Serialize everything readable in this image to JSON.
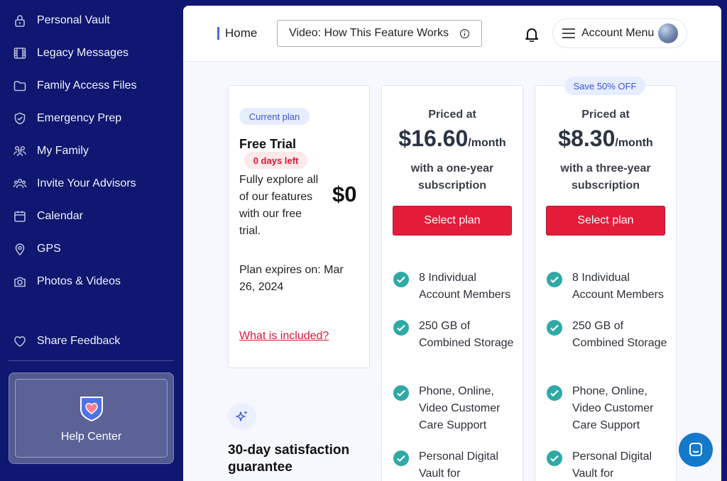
{
  "sidebar": {
    "items": [
      {
        "label": "Personal Vault",
        "icon": "lock-icon"
      },
      {
        "label": "Legacy Messages",
        "icon": "film-icon"
      },
      {
        "label": "Family Access Files",
        "icon": "folder-icon"
      },
      {
        "label": "Emergency Prep",
        "icon": "shield-check-icon"
      },
      {
        "label": "My Family",
        "icon": "family-icon"
      },
      {
        "label": "Invite Your Advisors",
        "icon": "group-icon"
      },
      {
        "label": "Calendar",
        "icon": "calendar-icon"
      },
      {
        "label": "GPS",
        "icon": "location-pin-icon"
      },
      {
        "label": "Photos & Videos",
        "icon": "camera-icon"
      }
    ],
    "feedback": "Share Feedback",
    "help_center": "Help Center"
  },
  "header": {
    "home": "Home",
    "video": "Video: How This Feature Works",
    "account": "Account Menu"
  },
  "free_plan": {
    "badge": "Current plan",
    "title": "Free Trial",
    "days_left": "0 days left",
    "description": "Fully explore all of our features with our free trial.",
    "price": "$0",
    "expires": "Plan expires on: Mar 26, 2024",
    "included_link": "What is included?"
  },
  "plans": [
    {
      "priced_at": "Priced at",
      "amount": "$16.60",
      "per": "/month",
      "term": "with a one-year subscription",
      "button": "Select plan",
      "features": [
        "8 Individual Account Members",
        "250 GB of Combined Storage",
        "Phone, Online, Video Customer Care Support",
        "Personal Digital Vault for"
      ]
    },
    {
      "priced_at": "Priced at",
      "amount": "$8.30",
      "per": "/month",
      "term": "with a three-year subscription",
      "button": "Select plan",
      "badge": "Save 50% OFF",
      "features": [
        "8 Individual Account Members",
        "250 GB of Combined Storage",
        "Phone, Online, Video Customer Care Support",
        "Personal Digital Vault for"
      ]
    }
  ],
  "guarantee": "30-day satisfaction guarantee",
  "colors": {
    "sidebar": "#0f1770",
    "accent": "#e41c3a",
    "check": "#2fa9a5",
    "link": "#3c57d5"
  }
}
